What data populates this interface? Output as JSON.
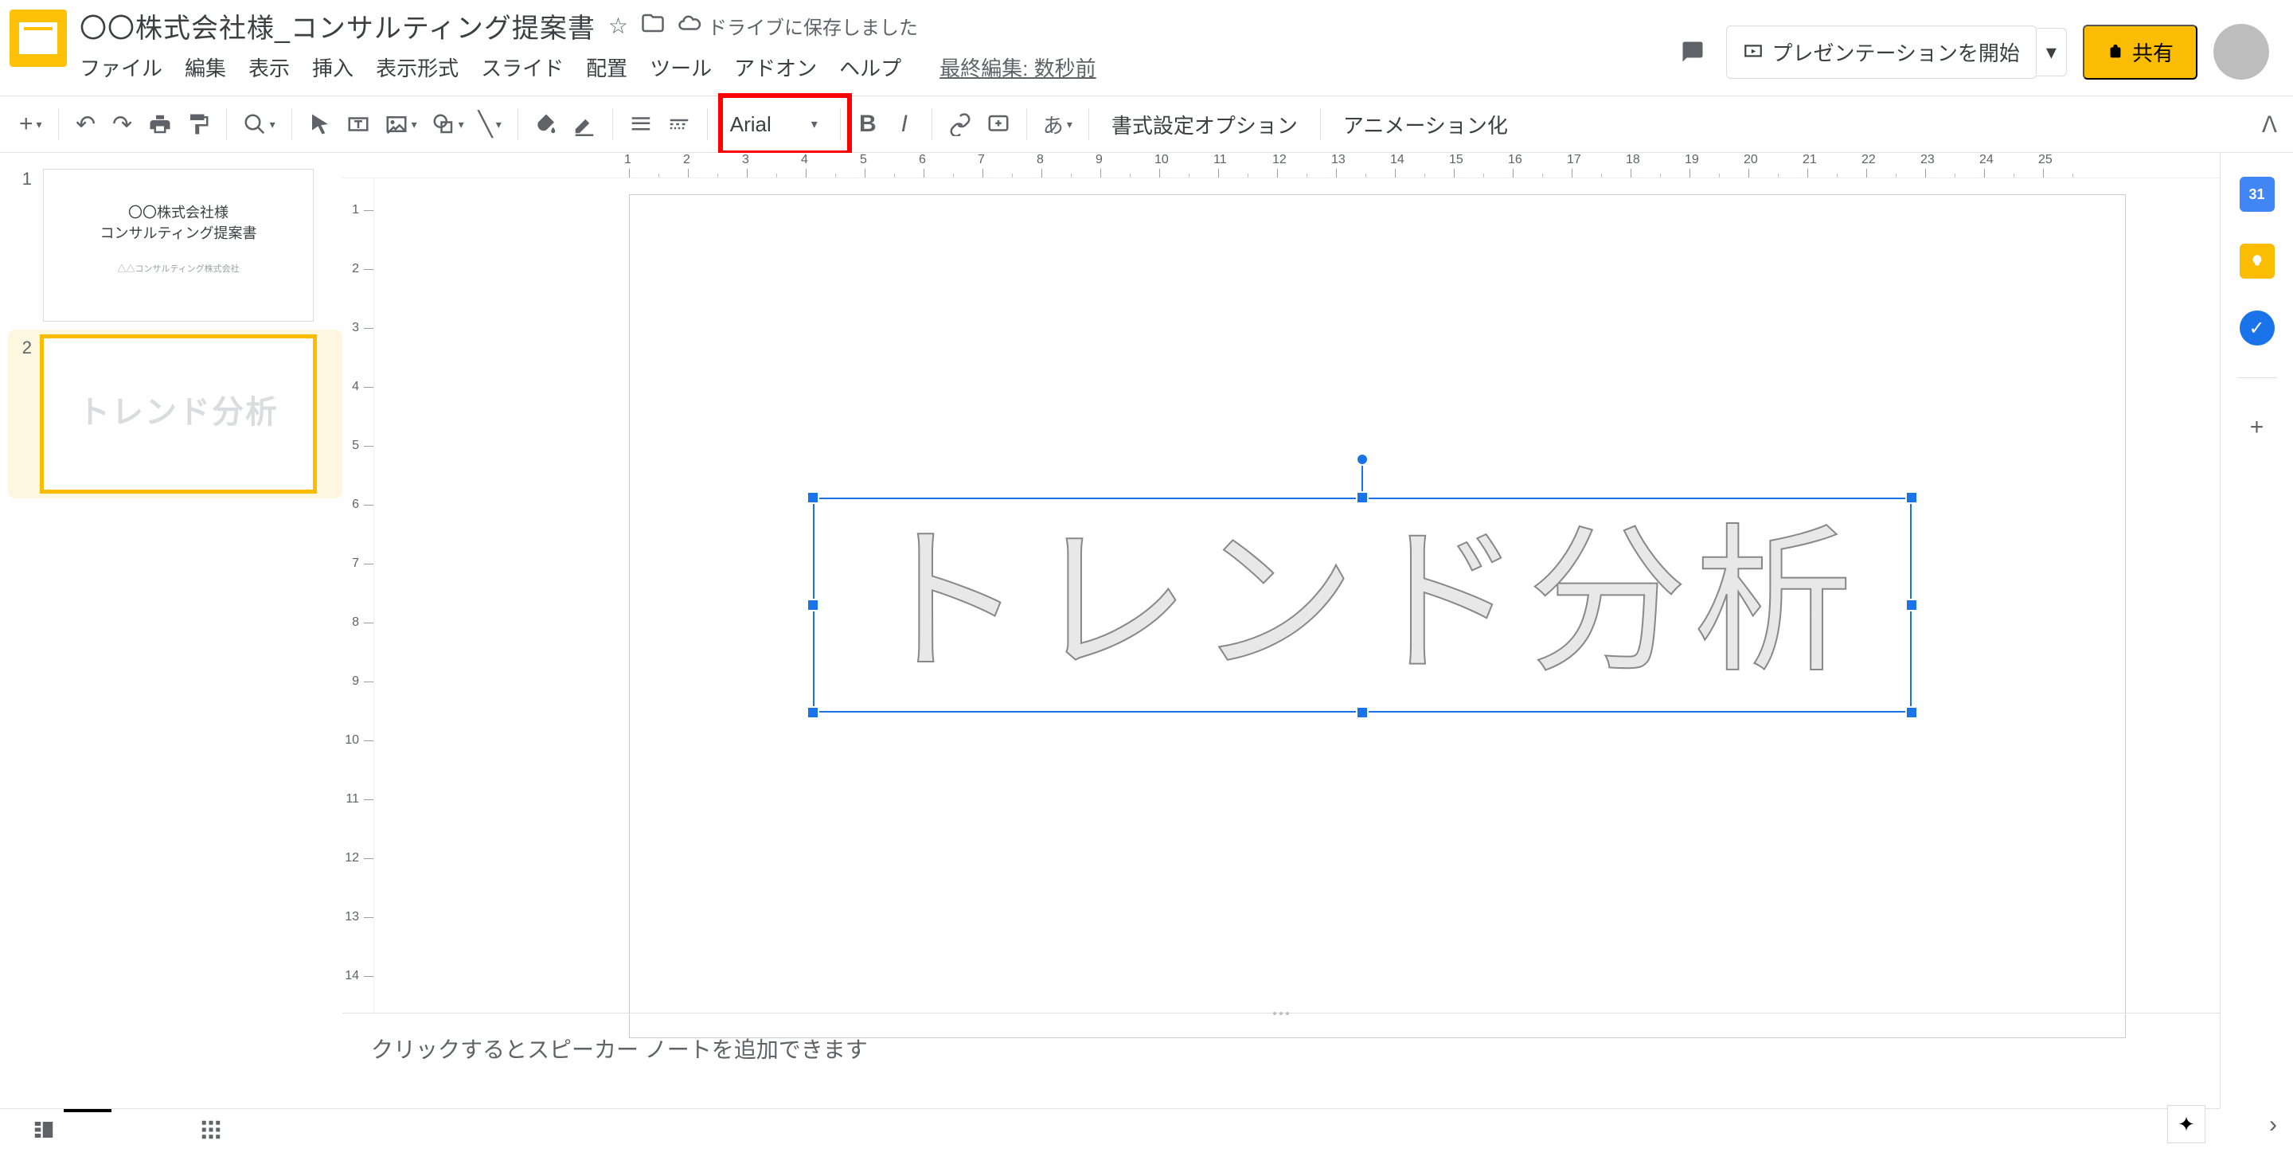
{
  "header": {
    "doc_title": "〇〇株式会社様_コンサルティング提案書",
    "saved_status": "ドライブに保存しました",
    "last_edit": "最終編集: 数秒前",
    "menu": {
      "file": "ファイル",
      "edit": "編集",
      "view": "表示",
      "insert": "挿入",
      "format": "表示形式",
      "slide": "スライド",
      "arrange": "配置",
      "tools": "ツール",
      "addons": "アドオン",
      "help": "ヘルプ"
    },
    "present_label": "プレゼンテーションを開始",
    "share_label": "共有"
  },
  "toolbar": {
    "font_name": "Arial",
    "format_options": "書式設定オプション",
    "animate": "アニメーション化",
    "translate_label": "あ"
  },
  "thumbnails": {
    "slide1": {
      "num": "1",
      "line1": "〇〇株式会社様",
      "line2": "コンサルティング提案書",
      "line3": "△△コンサルティング株式会社"
    },
    "slide2": {
      "num": "2",
      "text": "トレンド分析"
    }
  },
  "canvas": {
    "wordart_text": "トレンド分析"
  },
  "notes": {
    "placeholder": "クリックするとスピーカー ノートを追加できます"
  },
  "rsidebar": {
    "calendar_date": "31"
  },
  "ruler": {
    "h_labels": [
      "1",
      "2",
      "3",
      "4",
      "5",
      "6",
      "7",
      "8",
      "9",
      "10",
      "11",
      "12",
      "13",
      "14",
      "15",
      "16",
      "17",
      "18",
      "19",
      "20",
      "21",
      "22",
      "23",
      "24",
      "25"
    ],
    "v_labels": [
      "1",
      "2",
      "3",
      "4",
      "5",
      "6",
      "7",
      "8",
      "9",
      "10",
      "11",
      "12",
      "13",
      "14"
    ]
  }
}
